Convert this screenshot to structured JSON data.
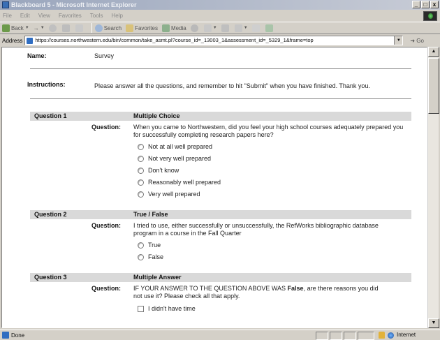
{
  "window": {
    "title": "Blackboard 5 - Microsoft Internet Explorer",
    "controls": [
      "_",
      "□",
      "x"
    ]
  },
  "menu": [
    "File",
    "Edit",
    "View",
    "Favorites",
    "Tools",
    "Help"
  ],
  "toolbar": {
    "back": "Back",
    "search": "Search",
    "favorites": "Favorites",
    "media": "Media"
  },
  "address": {
    "label": "Address",
    "url": "https://courses.northwestern.edu/bin/common/take_asmt.pl?course_id=_13003_1&assessment_id=_5329_1&frame=top",
    "go": "Go"
  },
  "page": {
    "name_label": "Name:",
    "name_value": "Survey",
    "instructions_label": "Instructions:",
    "instructions_value": "Please answer all the questions, and remember to hit \"Submit\" when you have finished. Thank you.",
    "question_label": "Question:",
    "questions": [
      {
        "number": "Question 1",
        "type": "Multiple Choice",
        "text": "When you came to Northwestern, did you feel your high school courses adequately prepared you for successfully completing research papers here?",
        "choices": [
          "Not at all well prepared",
          "Not very well prepared",
          "Don't know",
          "Reasonably well prepared",
          "Very well prepared"
        ]
      },
      {
        "number": "Question 2",
        "type": "True / False",
        "text": "I tried to use, either successfully or unsuccessfully, the RefWorks bibliographic database program in a course in the Fall Quarter",
        "choices": [
          "True",
          "False"
        ]
      },
      {
        "number": "Question 3",
        "type": "Multiple Answer",
        "text_before": "IF YOUR ANSWER TO THE QUESTION ABOVE WAS ",
        "text_bold": "False",
        "text_after": ", are there reasons you did not use it? Please check all that apply.",
        "choices": [
          "I didn't have time"
        ]
      }
    ]
  },
  "status": {
    "left": "Done",
    "zone": "Internet"
  },
  "colors": {
    "question_header_bg": "#d9d9d9",
    "chrome": "#d4d0c8"
  }
}
